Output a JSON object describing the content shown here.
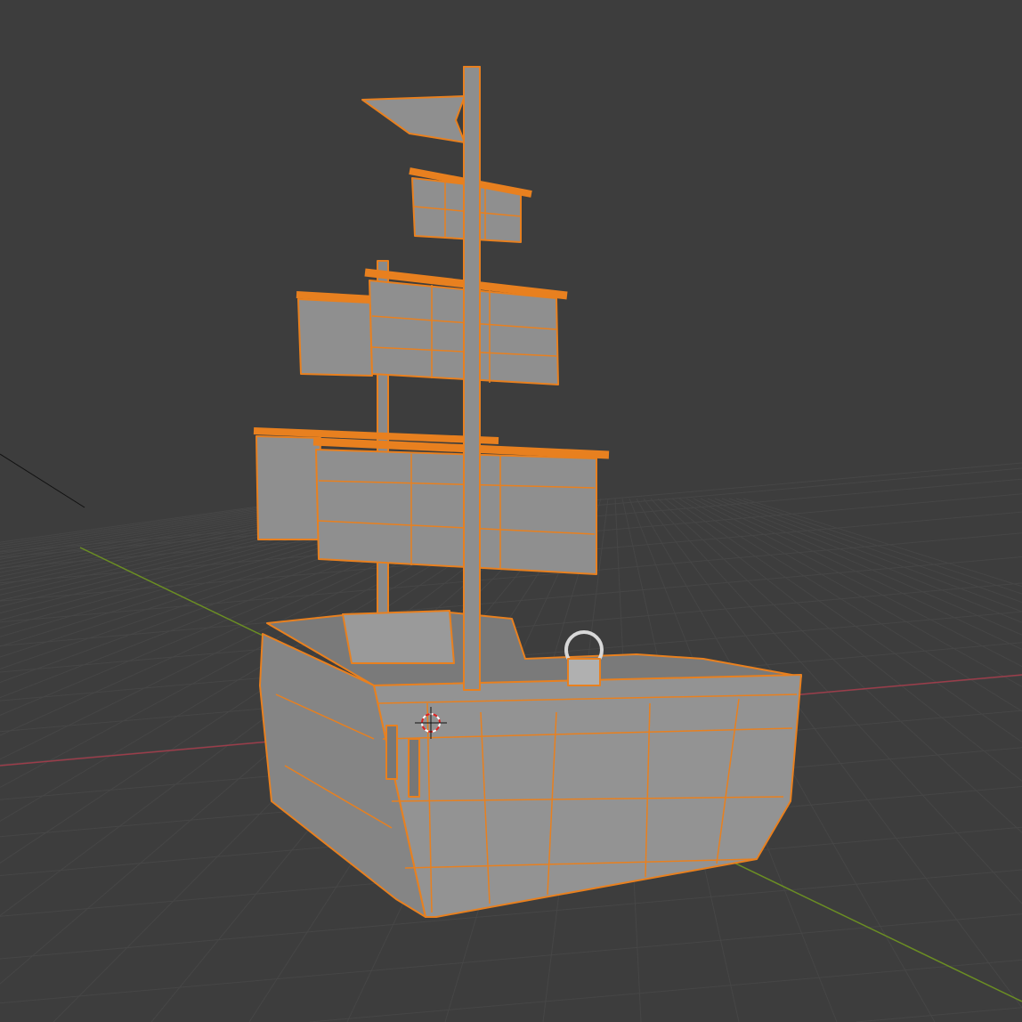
{
  "viewport": {
    "mode": "3d-viewport",
    "shading": "solid",
    "selected_object": "ship",
    "icons": [
      "3d-cursor-icon"
    ]
  },
  "colors": {
    "background": "#3d3d3d",
    "grid": "#4a4a4a",
    "x_axis": "#9b3d4a",
    "y_axis": "#6b8e23",
    "mesh_fill": "#8f8f8f",
    "selection_outline": "#e8801f"
  }
}
